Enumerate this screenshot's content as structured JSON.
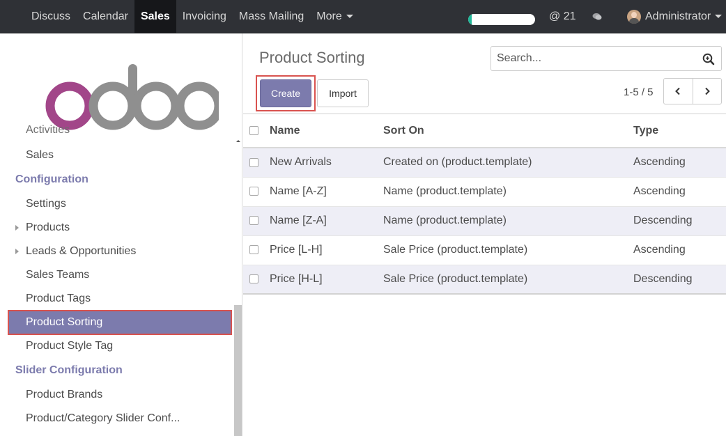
{
  "topbar": {
    "menu": [
      "Discuss",
      "Calendar",
      "Sales",
      "Invoicing",
      "Mass Mailing"
    ],
    "active_menu": "Sales",
    "more_label": "More",
    "progress": 0.05,
    "mention_count": "@ 21",
    "user_name": "Administrator"
  },
  "brand": {
    "logo_text": "odoo"
  },
  "sidebar": {
    "cut_item": "Activities",
    "sales_item": "Sales",
    "config_header": "Configuration",
    "config_items": [
      {
        "label": "Settings",
        "expandable": false
      },
      {
        "label": "Products",
        "expandable": true
      },
      {
        "label": "Leads & Opportunities",
        "expandable": true
      },
      {
        "label": "Sales Teams",
        "expandable": false
      },
      {
        "label": "Product Tags",
        "expandable": false
      },
      {
        "label": "Product Sorting",
        "expandable": false,
        "active": true
      },
      {
        "label": "Product Style Tag",
        "expandable": false
      }
    ],
    "slider_header": "Slider Configuration",
    "slider_items": [
      {
        "label": "Product Brands"
      },
      {
        "label": "Product/Category Slider Conf..."
      }
    ]
  },
  "main": {
    "title": "Product Sorting",
    "search_placeholder": "Search...",
    "create_label": "Create",
    "import_label": "Import",
    "pager": "1-5 / 5",
    "columns": [
      "Name",
      "Sort On",
      "Type"
    ],
    "rows": [
      {
        "name": "New Arrivals",
        "sort_on": "Created on (product.template)",
        "type": "Ascending"
      },
      {
        "name": "Name [A-Z]",
        "sort_on": "Name (product.template)",
        "type": "Ascending"
      },
      {
        "name": "Name [Z-A]",
        "sort_on": "Name (product.template)",
        "type": "Descending"
      },
      {
        "name": "Price [L-H]",
        "sort_on": "Sale Price (product.template)",
        "type": "Ascending"
      },
      {
        "name": "Price [H-L]",
        "sort_on": "Sale Price (product.template)",
        "type": "Descending"
      }
    ]
  },
  "colors": {
    "accent": "#7c7bad",
    "highlight": "#d9534f",
    "navbar": "#2f3136",
    "progress_fill": "#21b799"
  }
}
